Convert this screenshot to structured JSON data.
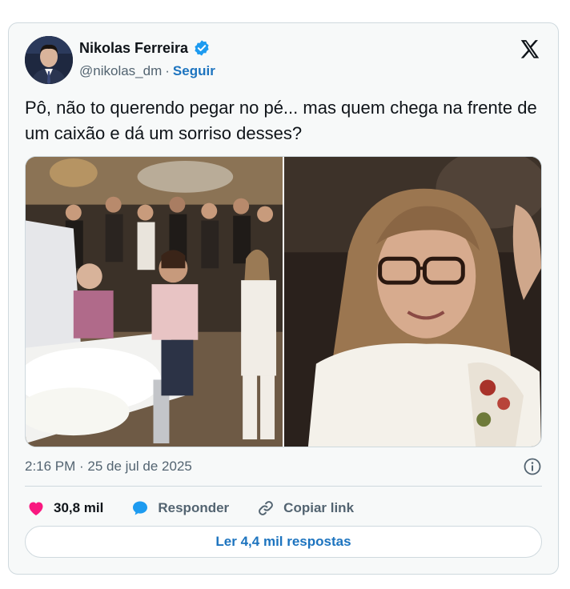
{
  "author": {
    "display_name": "Nikolas Ferreira",
    "handle": "@nikolas_dm",
    "separator": "·",
    "follow_label": "Seguir"
  },
  "tweet": {
    "text": "Pô, não to querendo pegar no pé... mas quem chega na frente de um caixão e dá um sorriso desses?",
    "timestamp": "2:16 PM · 25 de jul de 2025"
  },
  "actions": {
    "likes": "30,8 mil",
    "reply_label": "Responder",
    "copy_link_label": "Copiar link"
  },
  "read_replies_label": "Ler 4,4 mil respostas",
  "icons": {
    "verified": "verified-badge-icon",
    "logo": "x-logo-icon",
    "info": "info-icon",
    "like": "heart-icon",
    "reply": "speech-bubble-icon",
    "link": "link-icon"
  },
  "colors": {
    "accent": "#1d74bf",
    "verified": "#1d9bf0",
    "like": "#f91880",
    "reply": "#1d9bf0",
    "muted": "#536471",
    "text": "#0f1419"
  }
}
